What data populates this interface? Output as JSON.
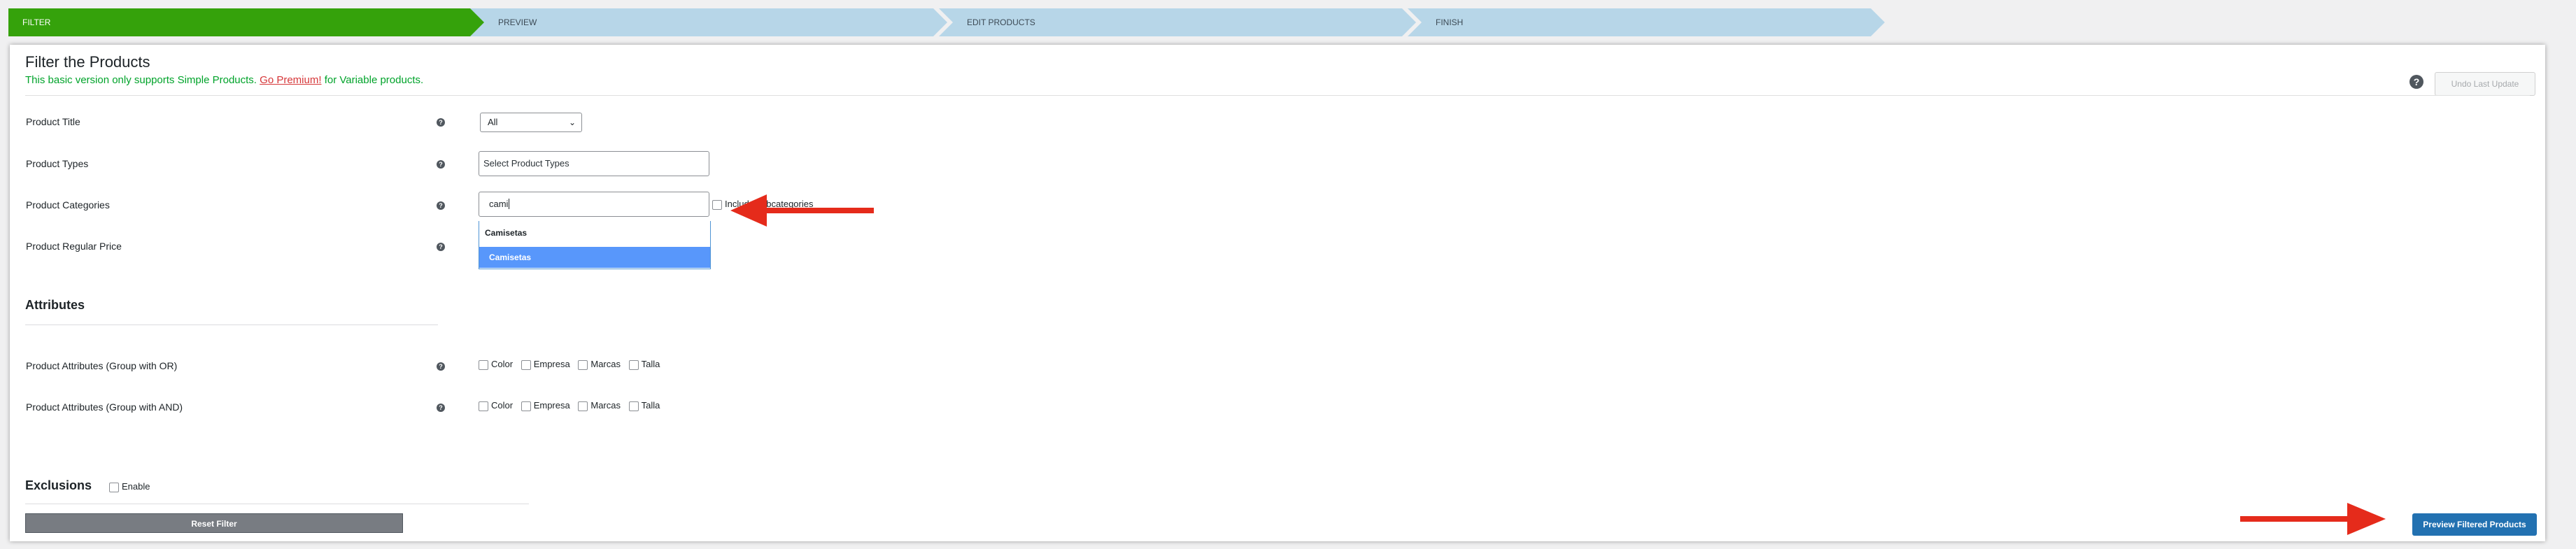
{
  "wizard": {
    "steps": [
      {
        "label": "FILTER",
        "active": true
      },
      {
        "label": "PREVIEW",
        "active": false
      },
      {
        "label": "EDIT PRODUCTS",
        "active": false
      },
      {
        "label": "FINISH",
        "active": false
      }
    ]
  },
  "card": {
    "title": "Filter the Products",
    "notice_pre": "This basic version only supports Simple Products.",
    "notice_link": "Go Premium!",
    "notice_post": "for Variable products.",
    "help_icon": "question-icon",
    "undo_label": "Undo Last Update"
  },
  "filters": {
    "product_title": {
      "label": "Product Title",
      "value": "All"
    },
    "product_types": {
      "label": "Product Types",
      "placeholder": "Select Product Types"
    },
    "product_categories": {
      "label": "Product Categories",
      "search_value": "cami",
      "include_subcategories": "Include subcategories",
      "options": [
        "Camisetas",
        "Camisetas"
      ]
    },
    "product_regular_price": {
      "label": "Product Regular Price"
    }
  },
  "attributes": {
    "title": "Attributes",
    "group_or": {
      "label": "Product Attributes (Group with OR)",
      "options": [
        "Color",
        "Empresa",
        "Marcas",
        "Talla"
      ]
    },
    "group_and": {
      "label": "Product Attributes (Group with AND)",
      "options": [
        "Color",
        "Empresa",
        "Marcas",
        "Talla"
      ]
    }
  },
  "exclusions": {
    "title": "Exclusions",
    "enable_label": "Enable"
  },
  "actions": {
    "reset_label": "Reset Filter",
    "preview_label": "Preview Filtered Products"
  },
  "colors": {
    "active_step": "#35a20b",
    "inactive_step": "#b7d6e8",
    "primary": "#2271b1",
    "annotation_arrow": "#e52b1b"
  }
}
